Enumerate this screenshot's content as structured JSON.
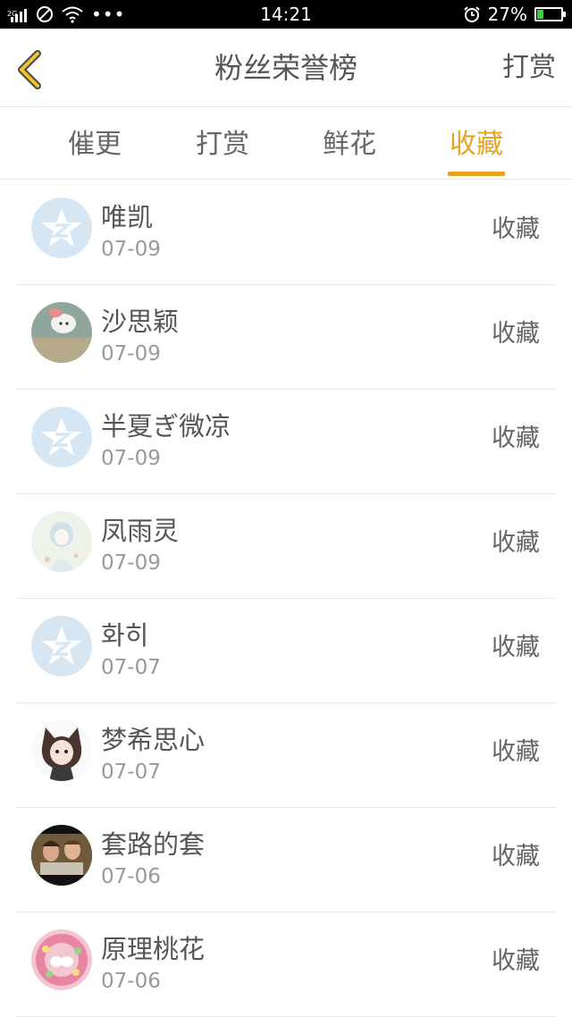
{
  "status_bar": {
    "network": "2G",
    "time": "14:21",
    "battery_percent_label": "27%",
    "battery_level": 0.27
  },
  "header": {
    "title": "粉丝荣誉榜",
    "action": "打赏"
  },
  "tabs": [
    {
      "label": "催更",
      "active": false
    },
    {
      "label": "打赏",
      "active": false
    },
    {
      "label": "鲜花",
      "active": false
    },
    {
      "label": "收藏",
      "active": true
    }
  ],
  "colors": {
    "accent": "#e8a320",
    "text": "#555555",
    "muted": "#999999",
    "divider": "#e6e6e6",
    "default_avatar": "#d7e6f3"
  },
  "rows": [
    {
      "name": "唯凯",
      "date": "07-09",
      "action": "收藏",
      "avatar": "default-qq-icon"
    },
    {
      "name": "沙思颖",
      "date": "07-09",
      "action": "收藏",
      "avatar": "white-dog-photo"
    },
    {
      "name": "半夏ぎ微凉",
      "date": "07-09",
      "action": "收藏",
      "avatar": "default-qq-icon"
    },
    {
      "name": "凤雨灵",
      "date": "07-09",
      "action": "收藏",
      "avatar": "anime-girl-sketch"
    },
    {
      "name": "화히",
      "date": "07-07",
      "action": "收藏",
      "avatar": "default-qq-icon"
    },
    {
      "name": "梦希思心",
      "date": "07-07",
      "action": "收藏",
      "avatar": "anime-cat-girl"
    },
    {
      "name": "套路的套",
      "date": "07-06",
      "action": "收藏",
      "avatar": "movie-couple-photo"
    },
    {
      "name": "原理桃花",
      "date": "07-06",
      "action": "收藏",
      "avatar": "flower-wreath-photo"
    }
  ]
}
